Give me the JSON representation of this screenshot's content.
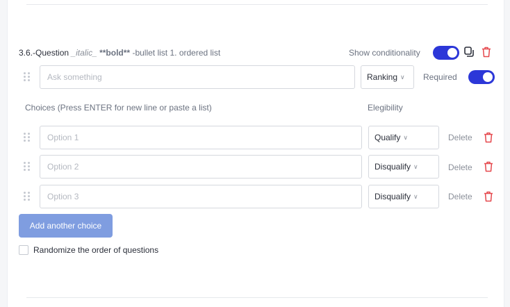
{
  "question": {
    "number": "3.6.-",
    "title_word": "Question",
    "italic_md": "_italic_",
    "bold_md": "**bold**",
    "rest_md": "-bullet list 1. ordered list",
    "prompt_placeholder": "Ask something",
    "type_value": "Ranking",
    "required_label": "Required",
    "required_on": true
  },
  "toolbar": {
    "show_conditionality_label": "Show conditionality",
    "show_conditionality_on": true,
    "icons": [
      "copy-icon",
      "trash-icon"
    ]
  },
  "choices_section": {
    "heading": "Choices (Press ENTER for new line or paste a list)",
    "eligibility_heading": "Elegibility"
  },
  "choices": [
    {
      "placeholder": "Option 1",
      "eligibility": "Qualify",
      "delete_label": "Delete"
    },
    {
      "placeholder": "Option 2",
      "eligibility": "Disqualify",
      "delete_label": "Delete"
    },
    {
      "placeholder": "Option 3",
      "eligibility": "Disqualify",
      "delete_label": "Delete"
    }
  ],
  "add_choice_label": "Add another choice",
  "randomize_label": "Randomize the order of questions",
  "colors": {
    "accent": "#2c37d8",
    "button": "#7f9de0",
    "danger": "#e5484d"
  }
}
